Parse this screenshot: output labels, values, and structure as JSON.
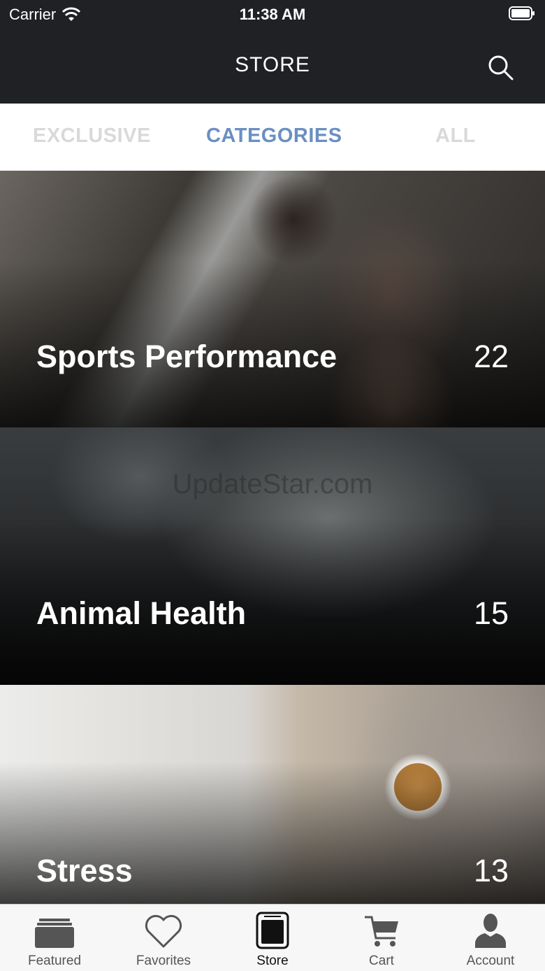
{
  "status_bar": {
    "carrier": "Carrier",
    "time": "11:38 AM"
  },
  "nav": {
    "title": "STORE"
  },
  "tabs": [
    {
      "label": "EXCLUSIVE",
      "state": "inactive"
    },
    {
      "label": "CATEGORIES",
      "state": "active"
    },
    {
      "label": "ALL",
      "state": "inactive"
    }
  ],
  "categories": [
    {
      "name": "Sports Performance",
      "count": "22"
    },
    {
      "name": "Animal Health",
      "count": "15"
    },
    {
      "name": "Stress",
      "count": "13"
    }
  ],
  "watermark": "UpdateStar.com",
  "tabbar": {
    "items": [
      {
        "label": "Featured",
        "icon": "featured-icon"
      },
      {
        "label": "Favorites",
        "icon": "heart-icon"
      },
      {
        "label": "Store",
        "icon": "store-icon",
        "active": true
      },
      {
        "label": "Cart",
        "icon": "cart-icon"
      },
      {
        "label": "Account",
        "icon": "account-icon"
      }
    ]
  },
  "colors": {
    "accent": "#6a8fc2",
    "header": "#1f2125",
    "tab_inactive": "#d9d9d9"
  }
}
